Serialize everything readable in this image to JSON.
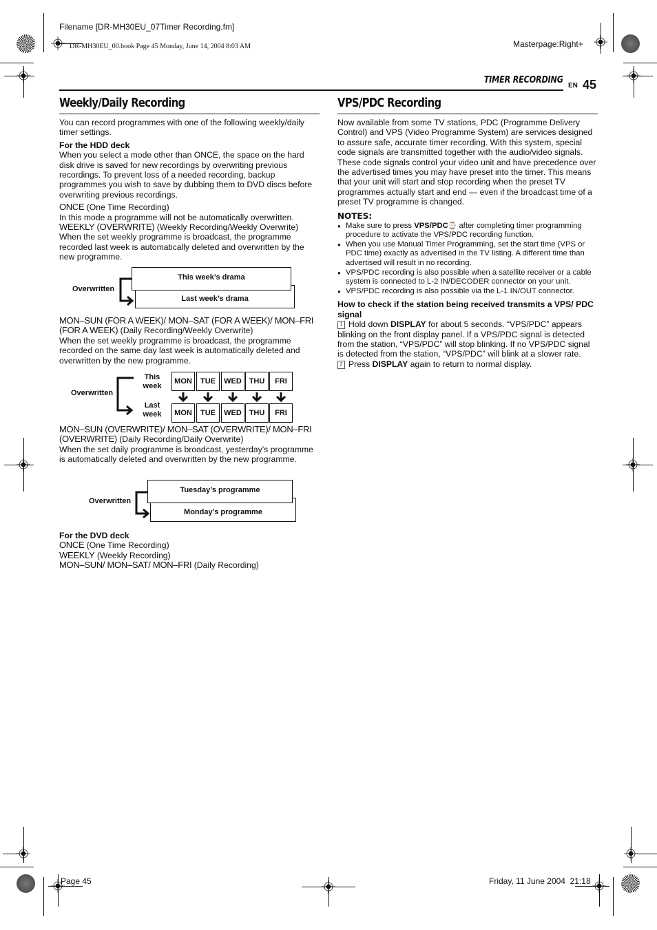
{
  "header": {
    "filename": "Filename [DR-MH30EU_07Timer Recording.fm]",
    "book_line": "DR-MH30EU_00.book  Page 45  Monday, June 14, 2004  8:03 AM",
    "masterpage": "Masterpage:Right+",
    "section": "TIMER RECORDING",
    "lang": "EN",
    "page_number": "45"
  },
  "left": {
    "title": "Weekly/Daily Recording",
    "intro": "You can record programmes with one of the following weekly/daily timer settings.",
    "hdd_heading": "For the HDD deck",
    "hdd_text": "When you select a mode other than ONCE, the space on the hard disk drive is saved for new recordings by overwriting previous recordings. To prevent loss of a needed recording, backup programmes you wish to save by dubbing them to DVD discs before overwriting previous recordings.",
    "once_mode": "ONCE",
    "once_desc": "(One Time Recording)",
    "once_text": "In this mode a programme will not be automatically overwritten.",
    "weekly_mode": "WEEKLY (OVERWRITE)",
    "weekly_desc": "(Weekly Recording/Weekly Overwrite)",
    "weekly_text": "When the set weekly programme is broadcast, the programme recorded last week is automatically deleted and overwritten by the new programme.",
    "diagram1": {
      "label": "Overwritten",
      "top_box": "This week’s drama",
      "bottom_box": "Last week’s drama"
    },
    "forweek_mode_line1": "MON–SUN (FOR A WEEK)/ MON–SAT (FOR A WEEK)/ MON–FRI",
    "forweek_mode_line2": "(FOR A WEEK)",
    "forweek_desc": "(Daily Recording/Weekly Overwrite)",
    "forweek_text": "When the set weekly programme is broadcast, the programme recorded on the same day last week is automatically deleted and overwritten by the new programme.",
    "diagram2": {
      "label": "Overwritten",
      "this_week": [
        "This",
        "week"
      ],
      "last_week": [
        "Last",
        "week"
      ],
      "days": [
        "MON",
        "TUE",
        "WED",
        "THU",
        "FRI"
      ]
    },
    "daily_mode_line1": "MON–SUN (OVERWRITE)/ MON–SAT (OVERWRITE)/ MON–FRI",
    "daily_mode_line2": "(OVERWRITE)",
    "daily_desc": "(Daily Recording/Daily Overwrite)",
    "daily_text": "When the set daily programme is broadcast, yesterday’s programme is automatically deleted and overwritten by the new programme.",
    "diagram3": {
      "label": "Overwritten",
      "top_box": "Tuesday’s programme",
      "bottom_box": "Monday’s programme"
    },
    "dvd_heading": "For the DVD deck",
    "dvd_items": [
      {
        "mode": "ONCE",
        "desc": "(One Time Recording)"
      },
      {
        "mode": "WEEKLY",
        "desc": "(Weekly Recording)"
      },
      {
        "mode": "MON–SUN/ MON–SAT/ MON–FRI",
        "desc": "(Daily Recording)"
      }
    ]
  },
  "right": {
    "title": "VPS/PDC Recording",
    "intro": "Now available from some TV stations, PDC (Programme Delivery Control) and VPS (Video Programme System) are services designed to assure safe, accurate timer recording. With this system, special code signals are transmitted together with the audio/video signals. These code signals control your video unit and have precedence over the advertised times you may have preset into the timer. This means that your unit will start and stop recording when the preset TV programmes actually start and end — even if the broadcast time of a preset TV programme is changed.",
    "notes_heading": "NOTES:",
    "notes": [
      {
        "pre": "Make sure to press ",
        "bold": "VPS/PDC",
        "icon": "⌚",
        "post": " after completing timer programming procedure to activate the VPS/PDC recording function."
      },
      {
        "pre": "When you use Manual Timer Programming, set the start time (VPS or PDC time) exactly as advertised in the TV listing. A different time than advertised will result in no recording.",
        "bold": "",
        "icon": "",
        "post": ""
      },
      {
        "pre": "VPS/PDC recording is also possible when a satellite receiver or a cable system is connected to L-2 IN/DECODER connector on your unit.",
        "bold": "",
        "icon": "",
        "post": ""
      },
      {
        "pre": "VPS/PDC recording is also possible via the L-1 IN/OUT connector.",
        "bold": "",
        "icon": "",
        "post": ""
      }
    ],
    "check_heading": "How to check if the station being received transmits a VPS/ PDC signal",
    "steps": [
      {
        "num": "1",
        "pre": "Hold down ",
        "bold": "DISPLAY",
        "post": " for about 5 seconds. “VPS/PDC” appears blinking on the front display panel. If a VPS/PDC signal is detected from the station, “VPS/PDC” will stop blinking. If no VPS/PDC signal is detected from the station, “VPS/PDC” will blink at a slower rate."
      },
      {
        "num": "2",
        "pre": "Press ",
        "bold": "DISPLAY",
        "post": " again to return to normal display."
      }
    ]
  },
  "footer": {
    "page": "Page 45",
    "date": "Friday, 11 June 2004  21:18"
  }
}
